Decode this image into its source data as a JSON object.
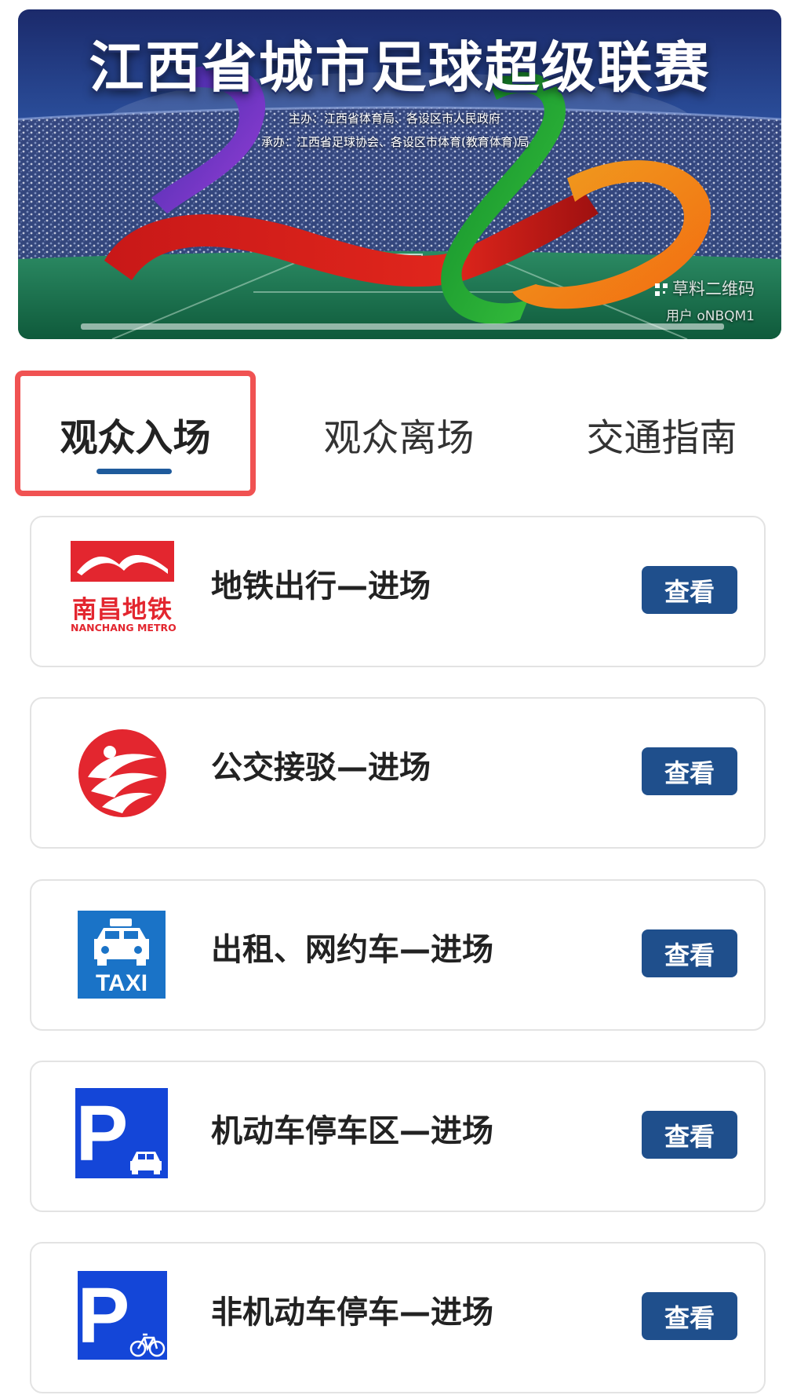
{
  "banner": {
    "title": "江西省城市足球超级联赛",
    "organizer": "主办：江西省体育局、各设区市人民政府",
    "undertaker": "承办：江西省足球协会、各设区市体育(教育体育)局",
    "watermark_line1": "草料二维码",
    "watermark_line2": "用户 oNBQM1"
  },
  "tabs": [
    {
      "label": "观众入场",
      "active": true
    },
    {
      "label": "观众离场",
      "active": false
    },
    {
      "label": "交通指南",
      "active": false
    }
  ],
  "items": [
    {
      "label": "地铁出行—进场",
      "button": "查看",
      "icon": "metro-logo-icon",
      "logo_cn": "南昌地铁",
      "logo_en": "NANCHANG METRO"
    },
    {
      "label": "公交接驳—进场",
      "button": "查看",
      "icon": "bus-logo-icon"
    },
    {
      "label": "出租、网约车—进场",
      "button": "查看",
      "icon": "taxi-icon",
      "icon_text": "TAXI"
    },
    {
      "label": "机动车停车区—进场",
      "button": "查看",
      "icon": "car-parking-icon",
      "icon_text": "P"
    },
    {
      "label": "非机动车停车—进场",
      "button": "查看",
      "icon": "bicycle-parking-icon",
      "icon_text": "P"
    }
  ],
  "colors": {
    "accent_blue": "#1f4f8c",
    "tab_underline": "#1f5b9c",
    "highlight_red": "#f05252",
    "metro_red": "#e3262f",
    "parking_blue": "#1446d8",
    "taxi_blue": "#1a73c7"
  }
}
